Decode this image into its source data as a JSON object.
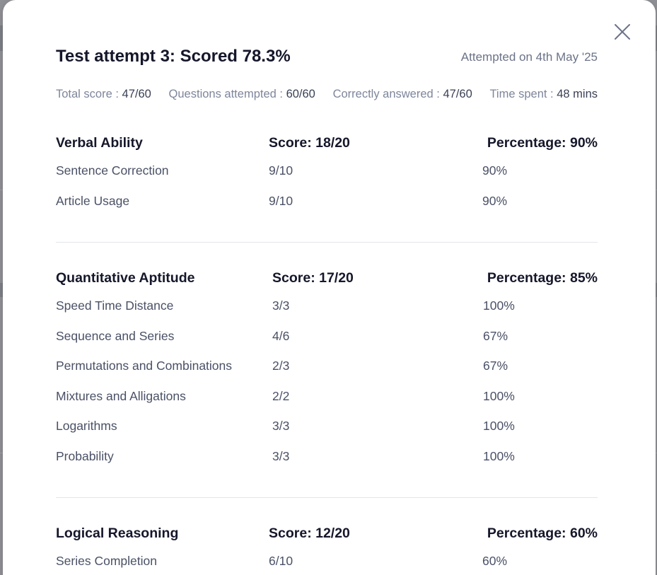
{
  "modal": {
    "title": "Test attempt 3: Scored 78.3%",
    "attempted_on": "Attempted on 4th May '25",
    "close_icon": "close-icon"
  },
  "stats": [
    {
      "label": "Total score : ",
      "value": "47/60"
    },
    {
      "label": "Questions attempted : ",
      "value": "60/60"
    },
    {
      "label": "Correctly answered : ",
      "value": "47/60"
    },
    {
      "label": "Time spent : ",
      "value": "48 mins"
    }
  ],
  "sections": [
    {
      "title": "Verbal Ability",
      "score": "Score: 18/20",
      "percentage": "Percentage: 90%",
      "topics": [
        {
          "name": "Sentence Correction",
          "score": "9/10",
          "percent": "90%"
        },
        {
          "name": "Article Usage",
          "score": "9/10",
          "percent": "90%"
        }
      ]
    },
    {
      "title": "Quantitative Aptitude",
      "score": "Score: 17/20",
      "percentage": "Percentage: 85%",
      "topics": [
        {
          "name": "Speed Time Distance",
          "score": "3/3",
          "percent": "100%"
        },
        {
          "name": "Sequence and Series",
          "score": "4/6",
          "percent": "67%"
        },
        {
          "name": "Permutations and Combinations",
          "score": "2/3",
          "percent": "67%"
        },
        {
          "name": "Mixtures and Alligations",
          "score": "2/2",
          "percent": "100%"
        },
        {
          "name": "Logarithms",
          "score": "3/3",
          "percent": "100%"
        },
        {
          "name": "Probability",
          "score": "3/3",
          "percent": "100%"
        }
      ]
    },
    {
      "title": "Logical Reasoning",
      "score": "Score: 12/20",
      "percentage": "Percentage: 60%",
      "topics": [
        {
          "name": "Series Completion",
          "score": "6/10",
          "percent": "60%"
        }
      ]
    }
  ]
}
